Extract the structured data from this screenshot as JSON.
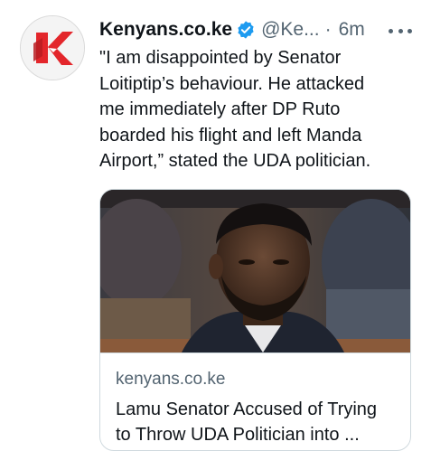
{
  "tweet": {
    "author_name": "Kenyans.co.ke",
    "handle": "@Ke...",
    "separator": "·",
    "time": "6m",
    "verified_icon": "verified-badge-icon",
    "more_icon": "more-options-icon",
    "avatar_icon": "kenyans-logo-icon",
    "text_lines": [
      "\"I am disappointed by Senator",
      "Loitiptip’s behaviour. He attacked",
      "me immediately after DP Ruto",
      "boarded his flight and left Manda",
      "Airport,” stated the UDA politician."
    ]
  },
  "card": {
    "domain": "kenyans.co.ke",
    "title_lines": [
      "Lamu Senator Accused of Trying",
      "to Throw UDA Politician into ..."
    ]
  },
  "colors": {
    "text": "#0f1419",
    "secondary": "#536471",
    "verified": "#1d9bf0",
    "logo_red": "#e3262b",
    "border": "#cfd9de"
  }
}
